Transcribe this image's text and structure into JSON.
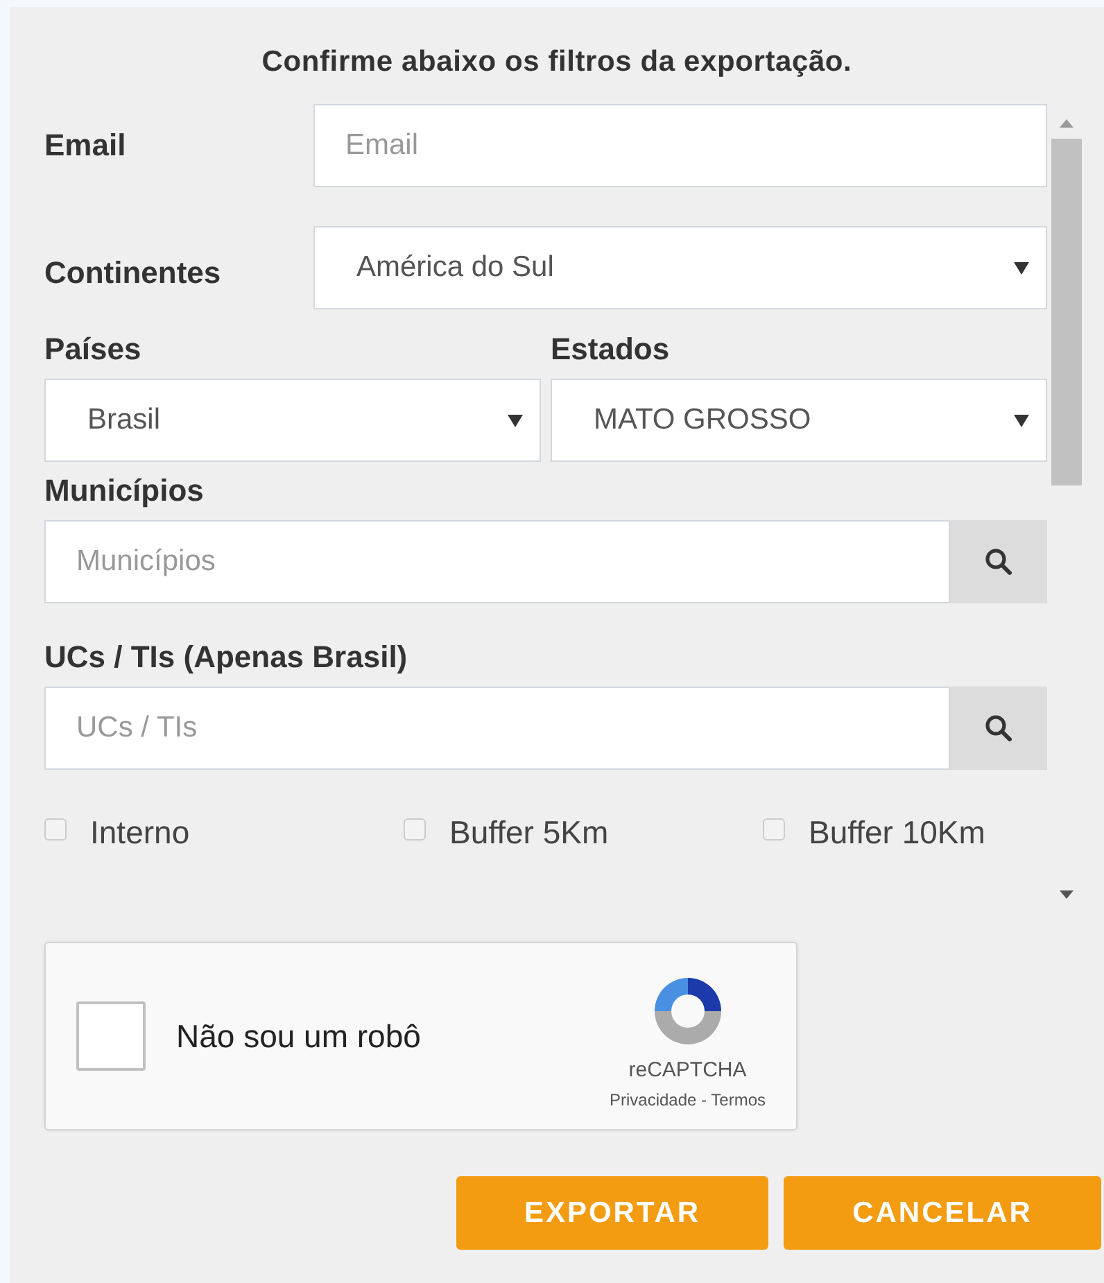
{
  "title": "Confirme abaixo os filtros da exportação.",
  "email": {
    "label": "Email",
    "placeholder": "Email"
  },
  "continent": {
    "label": "Continentes",
    "value": "América do Sul"
  },
  "country": {
    "label": "Países",
    "value": "Brasil"
  },
  "state": {
    "label": "Estados",
    "value": "MATO GROSSO"
  },
  "municipalities": {
    "label": "Municípios",
    "placeholder": "Municípios"
  },
  "protected_areas": {
    "label": "UCs / TIs (Apenas Brasil)",
    "placeholder": "UCs / TIs"
  },
  "options": [
    {
      "label": "Interno",
      "checked": false
    },
    {
      "label": "Buffer 5Km",
      "checked": false
    },
    {
      "label": "Buffer 10Km",
      "checked": false
    }
  ],
  "captcha": {
    "label": "Não sou um robô",
    "checked": false,
    "brand": "reCAPTCHA",
    "links": "Privacidade - Termos"
  },
  "buttons": [
    "EXPORTAR",
    "CANCELAR"
  ]
}
